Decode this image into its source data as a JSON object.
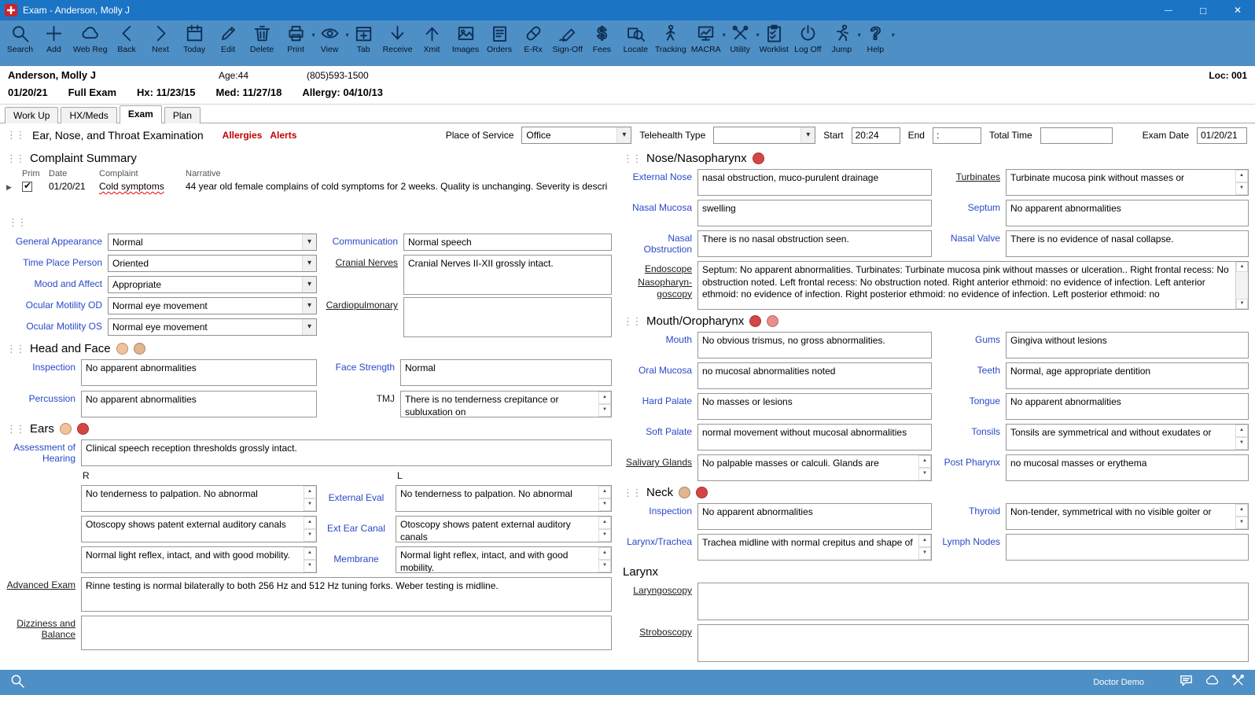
{
  "window": {
    "title": "Exam - Anderson, Molly J"
  },
  "colors": {
    "titlebar": "#1b74c4",
    "toolbar": "#4e8fc5",
    "label_blue": "#2949c8",
    "alert_red": "#c00000"
  },
  "toolbar": {
    "items": [
      {
        "label": "Search",
        "icon": "search-icon",
        "menu": false
      },
      {
        "label": "Add",
        "icon": "plus-icon",
        "menu": false
      },
      {
        "label": "Web Reg",
        "icon": "cloud-icon",
        "menu": false
      },
      {
        "label": "Back",
        "icon": "chevron-left-icon",
        "menu": false
      },
      {
        "label": "Next",
        "icon": "chevron-right-icon",
        "menu": false
      },
      {
        "label": "Today",
        "icon": "calendar-icon",
        "menu": false
      },
      {
        "label": "Edit",
        "icon": "pencil-icon",
        "menu": false
      },
      {
        "label": "Delete",
        "icon": "trash-icon",
        "menu": false
      },
      {
        "label": "Print",
        "icon": "printer-icon",
        "menu": true
      },
      {
        "label": "View",
        "icon": "eye-icon",
        "menu": true
      },
      {
        "label": "Tab",
        "icon": "tab-plus-icon",
        "menu": false
      },
      {
        "label": "Receive",
        "icon": "arrow-down-icon",
        "menu": false
      },
      {
        "label": "Xmit",
        "icon": "arrow-up-icon",
        "menu": false
      },
      {
        "label": "Images",
        "icon": "image-icon",
        "menu": false
      },
      {
        "label": "Orders",
        "icon": "orders-list-icon",
        "menu": false
      },
      {
        "label": "E-Rx",
        "icon": "pill-icon",
        "menu": false
      },
      {
        "label": "Sign-Off",
        "icon": "signature-icon",
        "menu": false
      },
      {
        "label": "Fees",
        "icon": "dollar-icon",
        "menu": false
      },
      {
        "label": "Locate",
        "icon": "locate-magnifier-icon",
        "menu": false
      },
      {
        "label": "Tracking",
        "icon": "walking-person-icon",
        "menu": false
      },
      {
        "label": "MACRA",
        "icon": "monitor-chart-icon",
        "menu": true
      },
      {
        "label": "Utility",
        "icon": "crossed-tools-icon",
        "menu": true
      },
      {
        "label": "Worklist",
        "icon": "clipboard-check-icon",
        "menu": false
      },
      {
        "label": "Log Off",
        "icon": "power-icon",
        "menu": false
      },
      {
        "label": "Jump",
        "icon": "running-person-icon",
        "menu": true
      },
      {
        "label": "Help",
        "icon": "question-icon",
        "menu": true
      }
    ]
  },
  "patient": {
    "name": "Anderson, Molly J",
    "age": "Age:44",
    "phone": "(805)593-1500",
    "location": "Loc: 001",
    "visit_date": "01/20/21",
    "visit_type": "Full Exam",
    "hx": "Hx: 11/23/15",
    "med": "Med: 11/27/18",
    "allergy": "Allergy: 04/10/13"
  },
  "tabs": {
    "items": [
      {
        "label": "Work Up",
        "active": false
      },
      {
        "label": "HX/Meds",
        "active": false
      },
      {
        "label": "Exam",
        "active": true
      },
      {
        "label": "Plan",
        "active": false
      }
    ]
  },
  "exam_header": {
    "title": "Ear, Nose, and Throat Examination",
    "allergies": "Allergies",
    "alerts": "Alerts",
    "place_of_service_label": "Place of Service",
    "place_of_service": "Office",
    "telehealth_label": "Telehealth Type",
    "telehealth": "",
    "start_label": "Start",
    "start": "20:24",
    "end_label": "End",
    "end": ":",
    "total_time_label": "Total Time",
    "total_time": "",
    "exam_date_label": "Exam Date",
    "exam_date": "01/20/21"
  },
  "complaint_summary": {
    "title": "Complaint Summary",
    "columns": {
      "prim": "Prim",
      "date": "Date",
      "complaint": "Complaint",
      "narrative": "Narrative"
    },
    "row": {
      "prim_checked": true,
      "date": "01/20/21",
      "complaint": "Cold symptoms",
      "narrative": "44 year old female complains of cold symptoms for 2 weeks.  Quality is unchanging.  Severity is descri"
    }
  },
  "general": {
    "fields": {
      "general_appearance": {
        "label": "General Appearance",
        "value": "Normal"
      },
      "time_place_person": {
        "label": "Time Place Person",
        "value": "Oriented"
      },
      "mood_affect": {
        "label": "Mood and Affect",
        "value": "Appropriate"
      },
      "ocular_od": {
        "label": "Ocular Motility OD",
        "value": "Normal eye movement"
      },
      "ocular_os": {
        "label": "Ocular Motility OS",
        "value": "Normal eye movement"
      },
      "communication": {
        "label": "Communication",
        "value": "Normal speech"
      },
      "cranial_nerves": {
        "label": "Cranial Nerves",
        "value": "Cranial Nerves II-XII grossly intact."
      },
      "cardiopulmonary": {
        "label": "Cardiopulmonary",
        "value": ""
      }
    }
  },
  "head_face": {
    "title": "Head and Face",
    "inspection": {
      "label": "Inspection",
      "value": "No apparent abnormalities"
    },
    "percussion": {
      "label": "Percussion",
      "value": "No apparent abnormalities"
    },
    "face_strength": {
      "label": "Face Strength",
      "value": "Normal"
    },
    "tmj": {
      "label": "TMJ",
      "value": "There is no tenderness crepitance or subluxation on"
    }
  },
  "ears": {
    "title": "Ears",
    "col_r": "R",
    "col_l": "L",
    "assessment": {
      "label": "Assessment of Hearing",
      "value": "Clinical speech reception thresholds grossly intact."
    },
    "external_eval": {
      "label": "External Eval",
      "r": "No tenderness to palpation. No abnormal",
      "l": "No tenderness to palpation. No abnormal"
    },
    "ext_ear_canal": {
      "label": "Ext Ear Canal",
      "r": "Otoscopy shows patent external auditory canals",
      "l": "Otoscopy shows patent external auditory canals"
    },
    "membrane": {
      "label": "Membrane",
      "r": "Normal light reflex, intact, and with good mobility.",
      "l": "Normal light reflex, intact, and with good mobility."
    },
    "advanced_exam": {
      "label": "Advanced Exam",
      "value": "Rinne testing is normal bilaterally to both 256 Hz and 512 Hz tuning forks.  Weber testing is midline."
    },
    "dizziness": {
      "label": "Dizziness and Balance",
      "value": ""
    }
  },
  "nose": {
    "title": "Nose/Nasopharynx",
    "external_nose": {
      "label": "External Nose",
      "value": "nasal obstruction, muco-purulent drainage"
    },
    "nasal_mucosa": {
      "label": "Nasal Mucosa",
      "value": "swelling"
    },
    "nasal_obstruction": {
      "label": "Nasal Obstruction",
      "value": "There is no nasal obstruction seen."
    },
    "turbinates": {
      "label": "Turbinates",
      "value": "Turbinate mucosa pink without masses or"
    },
    "septum": {
      "label": "Septum",
      "value": "No apparent abnormalities"
    },
    "nasal_valve": {
      "label": "Nasal Valve",
      "value": "There is no evidence of nasal collapse."
    },
    "endoscope": {
      "label": "Endoscope",
      "label2": "Nasopharyn-goscopy",
      "value": "Septum: No apparent abnormalities.  Turbinates: Turbinate mucosa pink without masses or ulceration..  Right frontal recess: No obstruction noted.  Left frontal recess: No obstruction noted.  Right anterior ethmoid: no evidence of infection.  Left anterior ethmoid: no evidence of infection.  Right posterior ethmoid: no evidence of infection.  Left posterior ethmoid: no"
    }
  },
  "mouth": {
    "title": "Mouth/Oropharynx",
    "mouth": {
      "label": "Mouth",
      "value": "No obvious trismus, no gross abnormalities."
    },
    "oral_mucosa": {
      "label": "Oral Mucosa",
      "value": "no mucosal abnormalities noted"
    },
    "hard_palate": {
      "label": "Hard Palate",
      "value": "No masses or lesions"
    },
    "soft_palate": {
      "label": "Soft Palate",
      "value": "normal movement without mucosal abnormalities"
    },
    "salivary_glands": {
      "label": "Salivary Glands",
      "value": "No palpable masses or calculi.  Glands are"
    },
    "gums": {
      "label": "Gums",
      "value": "Gingiva without lesions"
    },
    "teeth": {
      "label": "Teeth",
      "value": "Normal, age appropriate dentition"
    },
    "tongue": {
      "label": "Tongue",
      "value": "No apparent abnormalities"
    },
    "tonsils": {
      "label": "Tonsils",
      "value": "Tonsils are symmetrical and without exudates or"
    },
    "post_pharynx": {
      "label": "Post Pharynx",
      "value": "no mucosal masses or erythema"
    }
  },
  "neck": {
    "title": "Neck",
    "inspection": {
      "label": "Inspection",
      "value": "No apparent abnormalities"
    },
    "larynx_trachea": {
      "label": "Larynx/Trachea",
      "value": "Trachea midline with normal crepitus and shape of"
    },
    "thyroid": {
      "label": "Thyroid",
      "value": "Non-tender, symmetrical with no visible goiter or"
    },
    "lymph_nodes": {
      "label": "Lymph Nodes",
      "value": ""
    }
  },
  "larynx": {
    "title": "Larynx",
    "laryngoscopy": {
      "label": "Laryngoscopy",
      "value": ""
    },
    "stroboscopy": {
      "label": "Stroboscopy",
      "value": ""
    }
  },
  "statusbar": {
    "user": "Doctor Demo"
  }
}
